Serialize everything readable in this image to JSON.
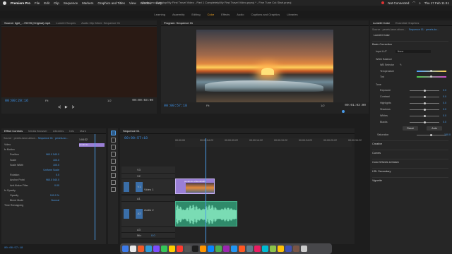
{
  "menubar": {
    "app": "Premiere Pro",
    "items": [
      "File",
      "Edit",
      "Clip",
      "Sequence",
      "Markers",
      "Graphics and Titles",
      "View",
      "Window",
      "Help"
    ],
    "path": "/Users/ursa/Desktop/My First Travel Video - Part 1 Completely/My First Travel Video.prproj * - Fine Tune Cut Start.prproj",
    "status": "Not Connected",
    "clock": "Thu 17 Feb 11:41"
  },
  "workspaces": {
    "tabs": [
      "Learning",
      "Assembly",
      "Editing",
      "Color",
      "Effects",
      "Audio",
      "Captions and Graphics",
      "Libraries"
    ],
    "active": "Color"
  },
  "source": {
    "tabs": [
      "Source: light_...70078 (Original).mp4",
      "Lumetri Scopes",
      "Audio Clip Mixer: Sequence 01"
    ],
    "tc_left": "00:00:20:16",
    "fit": "Fit",
    "scale": "1/2",
    "tc_right": "00:00:03:00"
  },
  "program": {
    "title": "Program: Sequence 01",
    "tc_left": "00:00:57:18",
    "fit": "Fit",
    "scale": "1/2",
    "tc_right": "00:01:03:00"
  },
  "lumetri": {
    "tabs": [
      "Lumetri Color",
      "Essential Graphics"
    ],
    "source": "Source · pexels-larue-alison...",
    "target": "Sequence 01 · pexels-ko...",
    "preset": "Lumetri Color",
    "basic": "Basic Correction",
    "input_lut_label": "Input LUT",
    "input_lut": "None",
    "wb": "White Balance",
    "wb_selector": "WB Selector",
    "temperature": "Temperature",
    "tint": "Tint",
    "tone": "Tone",
    "sliders": [
      {
        "label": "Exposure",
        "value": "0.0",
        "pos": 0.5
      },
      {
        "label": "Contrast",
        "value": "0.0",
        "pos": 0.5
      },
      {
        "label": "Highlights",
        "value": "0.0",
        "pos": 0.5
      },
      {
        "label": "Shadows",
        "value": "0.0",
        "pos": 0.5
      },
      {
        "label": "Whites",
        "value": "0.0",
        "pos": 0.5
      },
      {
        "label": "Blacks",
        "value": "0.0",
        "pos": 0.5
      }
    ],
    "reset": "Reset",
    "auto": "Auto",
    "saturation": "Saturation",
    "saturation_value": "100.0",
    "sections": [
      "Creative",
      "Curves",
      "Color Wheels & Match",
      "HSL Secondary",
      "Vignette"
    ]
  },
  "effects": {
    "tabs": [
      "Effect Controls",
      "Media Browser",
      "Libraries",
      "Info",
      "Mark"
    ],
    "source": "Source · pexels-larue-alison...",
    "target": "Sequence 01 · pexels-ko...",
    "tc": "1:04:32",
    "clip_label": "pexels-ko...",
    "rows": [
      {
        "label": "Video",
        "value": ""
      },
      {
        "label": "fx Motion",
        "value": ""
      },
      {
        "label": "Position",
        "value": "960.0 540.0"
      },
      {
        "label": "Scale",
        "value": "100.0"
      },
      {
        "label": "Scale Width",
        "value": "100.0"
      },
      {
        "label": "",
        "value": "Uniform Scale"
      },
      {
        "label": "Rotation",
        "value": "0.0"
      },
      {
        "label": "Anchor Point",
        "value": "960.0 540.0"
      },
      {
        "label": "Anti-flicker Filter",
        "value": "0.00"
      },
      {
        "label": "fx Opacity",
        "value": ""
      },
      {
        "label": "Opacity",
        "value": "100.0 %"
      },
      {
        "label": "Blend Mode",
        "value": "Normal"
      },
      {
        "label": "Time Remapping",
        "value": ""
      }
    ],
    "bottom_tc": "00:00:57:18"
  },
  "timeline": {
    "title": "Sequence 01",
    "tc": "00:00:57:18",
    "ruler": [
      "00:00:00",
      "00:00:04:22",
      "00:00:09:22",
      "00:00:14:22",
      "00:00:19:22",
      "00:00:24:22",
      "00:00:29:22",
      "00:00:34:22"
    ],
    "tracks": [
      "V3",
      "V2",
      "V1",
      "A1",
      "A2",
      "A3",
      "Mix"
    ],
    "v1_name": "Video 1",
    "a2_name": "Audio 2",
    "mix_value": "0.0",
    "video_clip": "pexels-ko-videodetail0",
    "playhead_fraction": 0.17
  },
  "dock_colors": [
    "#3d7bea",
    "#e8e8e8",
    "#f05a28",
    "#2f9ad8",
    "#7c4dff",
    "#34c759",
    "#ffcc00",
    "#ff3b30",
    "#555",
    "#1e1e1e",
    "#ff9500",
    "#0a84ff",
    "#4caf50",
    "#9c27b0",
    "#2196f3",
    "#ff5722",
    "#607d8b",
    "#e91e63",
    "#00bcd4",
    "#8bc34a",
    "#ffc107",
    "#3f51b5",
    "#795548",
    "#ccc"
  ]
}
